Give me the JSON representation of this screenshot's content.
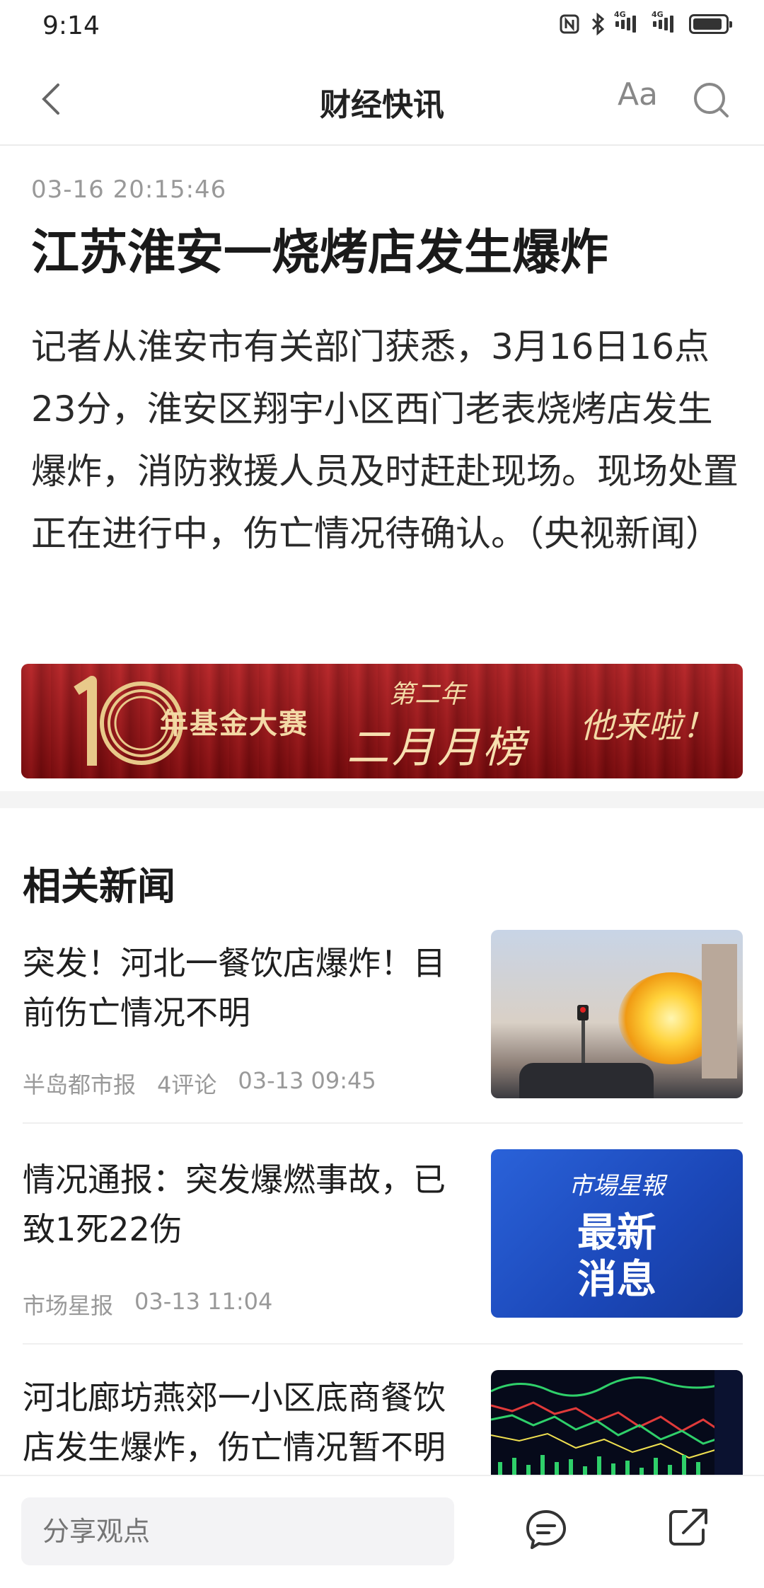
{
  "status_bar": {
    "time": "9:14",
    "net1": "4G",
    "net2": "4G"
  },
  "nav": {
    "title": "财经快讯",
    "font_label": "Aa"
  },
  "article": {
    "time": "03-16 20:15:46",
    "headline": "江苏淮安一烧烤店发生爆炸",
    "body": "记者从淮安市有关部门获悉，3月16日16点23分，淮安区翔宇小区西门老表烧烤店发生爆炸，消防救援人员及时赶赴现场。现场处置正在进行中，伤亡情况待确认。（央视新闻）"
  },
  "banner": {
    "text1": "年基金大赛",
    "text2": "第二年",
    "text3": "二月月榜",
    "text4": "他来啦！"
  },
  "related": {
    "title": "相关新闻",
    "items": [
      {
        "title": "突发！河北一餐饮店爆炸！目前伤亡情况不明",
        "source": "半岛都市报",
        "comments": "4评论",
        "time": "03-13 09:45"
      },
      {
        "title": "情况通报：突发爆燃事故，已致1死22伤",
        "source": "市场星报",
        "time": "03-13 11:04",
        "thumb_line1": "市場星報",
        "thumb_line2": "最新",
        "thumb_line3": "消息"
      },
      {
        "title": "河北廊坊燕郊一小区底商餐饮店发生爆炸，伤亡情况暂不明"
      }
    ]
  },
  "bottom_bar": {
    "input_placeholder": "分享观点"
  }
}
